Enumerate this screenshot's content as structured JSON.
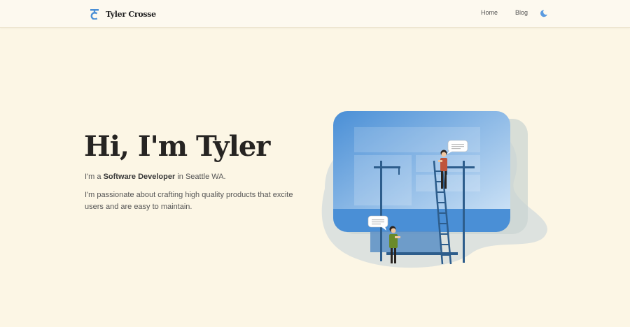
{
  "header": {
    "brand_name": "Tyler Crosse",
    "logo_icon": "tc-monogram-logo",
    "nav": [
      {
        "label": "Home"
      },
      {
        "label": "Blog"
      }
    ],
    "theme_toggle_icon": "moon-icon"
  },
  "hero": {
    "title": "Hi, I'm Tyler",
    "intro_prefix": "I'm a ",
    "intro_role": "Software Developer",
    "intro_suffix": " in Seattle WA.",
    "description": "I'm passionate about crafting high quality products that excite users and are easy to maintain."
  },
  "colors": {
    "background": "#fcf6e5",
    "header_background": "#fdf9ef",
    "accent_blue": "#4a8fd6",
    "title_text": "#262422",
    "body_text": "#555555"
  }
}
